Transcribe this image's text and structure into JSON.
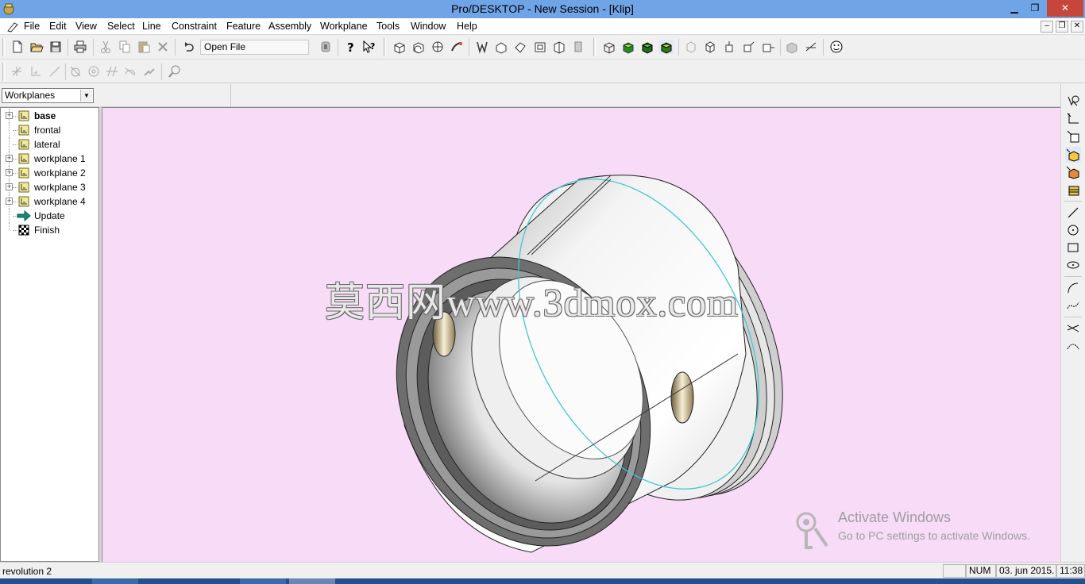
{
  "window": {
    "title": "Pro/DESKTOP - New Session - [Klip]",
    "minimize": "▁",
    "restore": "❐",
    "close": "✕"
  },
  "menu": {
    "items": [
      "File",
      "Edit",
      "View",
      "Select",
      "Line",
      "Constraint",
      "Feature",
      "Assembly",
      "Workplane",
      "Tools",
      "Window",
      "Help"
    ],
    "mdi_minimize": "–",
    "mdi_restore": "❐",
    "mdi_close": "✕"
  },
  "toolbar": {
    "open_file_label": "Open File"
  },
  "browser": {
    "selector_value": "Workplanes",
    "tree": [
      {
        "label": "base",
        "bold": true,
        "expandable": true,
        "icon": "workplane-icon"
      },
      {
        "label": "frontal",
        "bold": false,
        "expandable": false,
        "icon": "workplane-icon"
      },
      {
        "label": "lateral",
        "bold": false,
        "expandable": false,
        "icon": "workplane-icon"
      },
      {
        "label": "workplane 1",
        "bold": false,
        "expandable": true,
        "icon": "workplane-icon"
      },
      {
        "label": "workplane 2",
        "bold": false,
        "expandable": true,
        "icon": "workplane-icon"
      },
      {
        "label": "workplane 3",
        "bold": false,
        "expandable": true,
        "icon": "workplane-icon"
      },
      {
        "label": "workplane 4",
        "bold": false,
        "expandable": true,
        "icon": "workplane-icon"
      },
      {
        "label": "Update",
        "bold": false,
        "expandable": false,
        "icon": "update-arrow-icon"
      },
      {
        "label": "Finish",
        "bold": false,
        "expandable": false,
        "icon": "checkered-flag-icon"
      }
    ]
  },
  "viewport": {
    "background": "#f7dbf7",
    "watermark": "莫西网www.3dmox.com",
    "activation_title": "Activate Windows",
    "activation_text": "Go to PC settings to activate Windows."
  },
  "status": {
    "message": "revolution 2",
    "num": "NUM",
    "date": "03. jun 2015.",
    "time": "11:38"
  },
  "colors": {
    "titlebar": "#6fa4e6",
    "close_button": "#c7463a",
    "taskbar": "#25508d",
    "model_edge_highlight": "#3fc7d6"
  }
}
